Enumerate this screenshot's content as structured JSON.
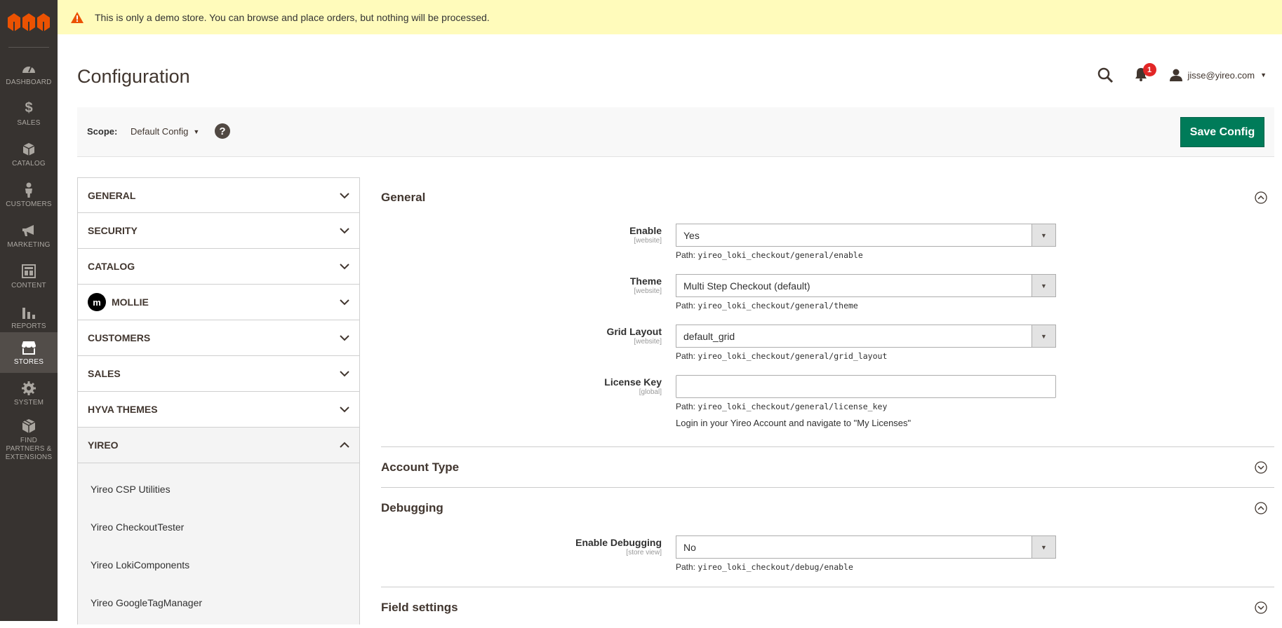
{
  "notice": {
    "text": "This is only a demo store. You can browse and place orders, but nothing will be processed."
  },
  "nav": [
    {
      "label": "DASHBOARD",
      "icon": "dashboard-icon"
    },
    {
      "label": "SALES",
      "icon": "dollar-icon"
    },
    {
      "label": "CATALOG",
      "icon": "box-icon"
    },
    {
      "label": "CUSTOMERS",
      "icon": "person-icon"
    },
    {
      "label": "MARKETING",
      "icon": "megaphone-icon"
    },
    {
      "label": "CONTENT",
      "icon": "layout-icon"
    },
    {
      "label": "REPORTS",
      "icon": "bar-chart-icon"
    },
    {
      "label": "STORES",
      "icon": "store-icon"
    },
    {
      "label": "SYSTEM",
      "icon": "gear-icon"
    },
    {
      "label": "FIND PARTNERS & EXTENSIONS",
      "icon": "package-icon"
    }
  ],
  "page": {
    "title": "Configuration"
  },
  "header": {
    "notification_count": "1",
    "user": "jisse@yireo.com"
  },
  "scope": {
    "label": "Scope:",
    "value": "Default Config",
    "help": "?"
  },
  "toolbar": {
    "save_label": "Save Config"
  },
  "tabs": [
    {
      "label": "GENERAL"
    },
    {
      "label": "SECURITY"
    },
    {
      "label": "CATALOG"
    },
    {
      "label": "MOLLIE"
    },
    {
      "label": "CUSTOMERS"
    },
    {
      "label": "SALES"
    },
    {
      "label": "HYVA THEMES"
    },
    {
      "label": "YIREO"
    }
  ],
  "mollie_logo_letter": "m",
  "subtabs": [
    {
      "label": "Yireo CSP Utilities"
    },
    {
      "label": "Yireo CheckoutTester"
    },
    {
      "label": "Yireo LokiComponents"
    },
    {
      "label": "Yireo GoogleTagManager"
    }
  ],
  "sections": {
    "general": {
      "title": "General",
      "fields": [
        {
          "label": "Enable",
          "scope": "[website]",
          "value": "Yes",
          "path_prefix": "Path: ",
          "path": "yireo_loki_checkout/general/enable"
        },
        {
          "label": "Theme",
          "scope": "[website]",
          "value": "Multi Step Checkout (default)",
          "path_prefix": "Path: ",
          "path": "yireo_loki_checkout/general/theme"
        },
        {
          "label": "Grid Layout",
          "scope": "[website]",
          "value": "default_grid",
          "path_prefix": "Path: ",
          "path": "yireo_loki_checkout/general/grid_layout"
        },
        {
          "label": "License Key",
          "scope": "[global]",
          "value": "",
          "path_prefix": "Path: ",
          "path": "yireo_loki_checkout/general/license_key",
          "note": "Login in your Yireo Account and navigate to \"My Licenses\""
        }
      ]
    },
    "account_type": {
      "title": "Account Type"
    },
    "debugging": {
      "title": "Debugging",
      "fields": [
        {
          "label": "Enable Debugging",
          "scope": "[store view]",
          "value": "No",
          "path_prefix": "Path: ",
          "path": "yireo_loki_checkout/debug/enable"
        }
      ]
    },
    "field_settings": {
      "title": "Field settings"
    }
  },
  "colors": {
    "sidebar": "#373330",
    "notice": "#fffbbb",
    "save_button": "#007b59",
    "badge": "#e22626",
    "logo": "#eb5202"
  }
}
